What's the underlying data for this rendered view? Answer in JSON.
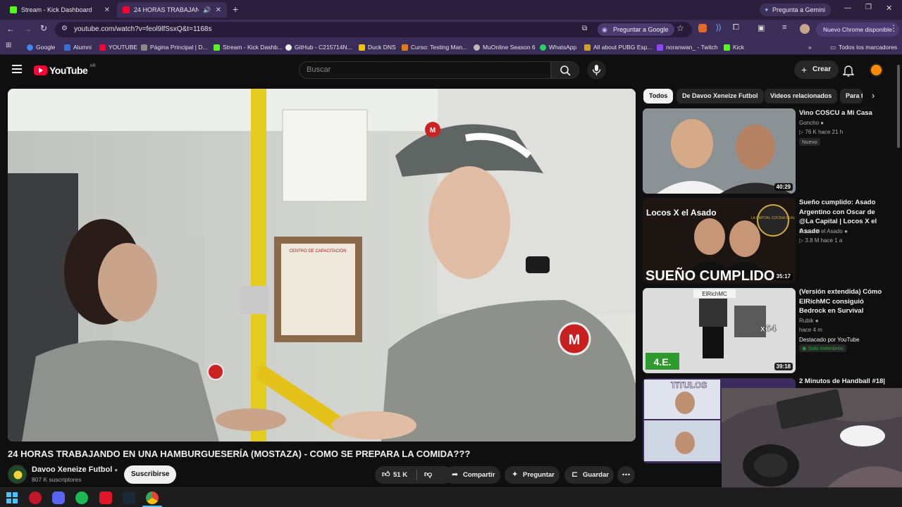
{
  "colors": {
    "youtube_red": "#ff0033",
    "tab_bg": "#2a1f3d",
    "toolbar_bg": "#3a2d57",
    "page_bg": "#0f0f0f",
    "kick_green": "#53fc18"
  },
  "tabs": [
    {
      "label": "Stream - Kick Dashboard",
      "favicon": "kick-icon",
      "active": false
    },
    {
      "label": "24 HORAS TRABAJANDO E",
      "favicon": "youtube-icon",
      "active": true
    }
  ],
  "browser": {
    "gemini_label": "Pregunta a Gemini",
    "url": "youtube.com/watch?v=feol9lfSsxQ&t=1168s",
    "ask_google_label": "Preguntar a Google",
    "new_chrome_label": "Nuevo Chrome disponible"
  },
  "bookmarks": {
    "items": [
      {
        "label": "Google",
        "icon": "google-icon"
      },
      {
        "label": "Alumni",
        "icon": "alumni-icon"
      },
      {
        "label": "YOUTUBE",
        "icon": "youtube-icon"
      },
      {
        "label": "Página Principal | D...",
        "icon": "page-icon"
      },
      {
        "label": "Stream - Kick Dashb...",
        "icon": "kick-icon"
      },
      {
        "label": "GitHub - C215714N...",
        "icon": "github-icon"
      },
      {
        "label": "Duck DNS",
        "icon": "duck-icon"
      },
      {
        "label": "Curso: Testing Man...",
        "icon": "course-icon"
      },
      {
        "label": "MuOnline Season 6",
        "icon": "muonline-icon"
      },
      {
        "label": "WhatsApp",
        "icon": "whatsapp-icon"
      },
      {
        "label": "All about PUBG Esp...",
        "icon": "pubg-icon"
      },
      {
        "label": "noranwan_ - Twitch",
        "icon": "twitch-icon"
      },
      {
        "label": "Kick",
        "icon": "kick-icon"
      }
    ],
    "overflow_label": "»",
    "all_label": "Todos los marcadores"
  },
  "youtube": {
    "logo_text": "YouTube",
    "region": "AR",
    "search_placeholder": "Buscar",
    "create_label": "Crear"
  },
  "video": {
    "title": "24 HORAS TRABAJANDO EN UNA HAMBURGUESERÍA (MOSTAZA) - COMO SE PREPARA LA COMIDA???",
    "channel": "Davoo Xeneize Futbol",
    "subscribers": "807 K suscriptores",
    "subscribe_label": "Suscribirse",
    "likes": "51 K",
    "share_label": "Compartir",
    "ask_label": "Preguntar",
    "save_label": "Guardar"
  },
  "chips": [
    "Todos",
    "De Davoo Xeneize Futbol",
    "Videos relacionados",
    "Para ti"
  ],
  "recommendations": [
    {
      "title": "Vino COSCU a Mi Casa",
      "channel": "Goncho",
      "verified": true,
      "views": "76 K",
      "age": "hace 21 h",
      "badge": "Nuevo",
      "duration": "40:29"
    },
    {
      "title": "Sueño cumplido: Asado Argentino con Oscar de @La Capital  | Locos X el Asado",
      "channel": "Locos X el Asado",
      "verified": true,
      "views": "3.8 M",
      "age": "hace 1 a",
      "duration": "35:17",
      "thumb_text_1": "Locos X el Asado",
      "thumb_text_2": "SUEÑO CUMPLIDO",
      "thumb_text_3": "LA CAPITAL COCINA REAL"
    },
    {
      "title": "(Versión extendida) Cómo ElRichMC consiguió Bedrock en Survival",
      "channel": "Rubik",
      "verified": true,
      "age": "hace 4 m",
      "featured": "Destacado por YouTube",
      "members": "Solo miembros",
      "duration": "39:18",
      "thumb_text_1": "ElRichMC",
      "thumb_text_2": "x64",
      "thumb_text_3": "4.E."
    },
    {
      "title": "2 Minutos de Handball #18|",
      "thumb_text_1": "TITULOS"
    }
  ],
  "video_overlay_text": {
    "shirt_logo": "M",
    "menu_board": "CENTRO DE CAPACITACIÓN"
  },
  "taskbar": [
    "windows-start-icon",
    "opera-gx-icon",
    "discord-icon",
    "spotify-icon",
    "app-red-icon",
    "steam-icon",
    "chrome-icon"
  ]
}
